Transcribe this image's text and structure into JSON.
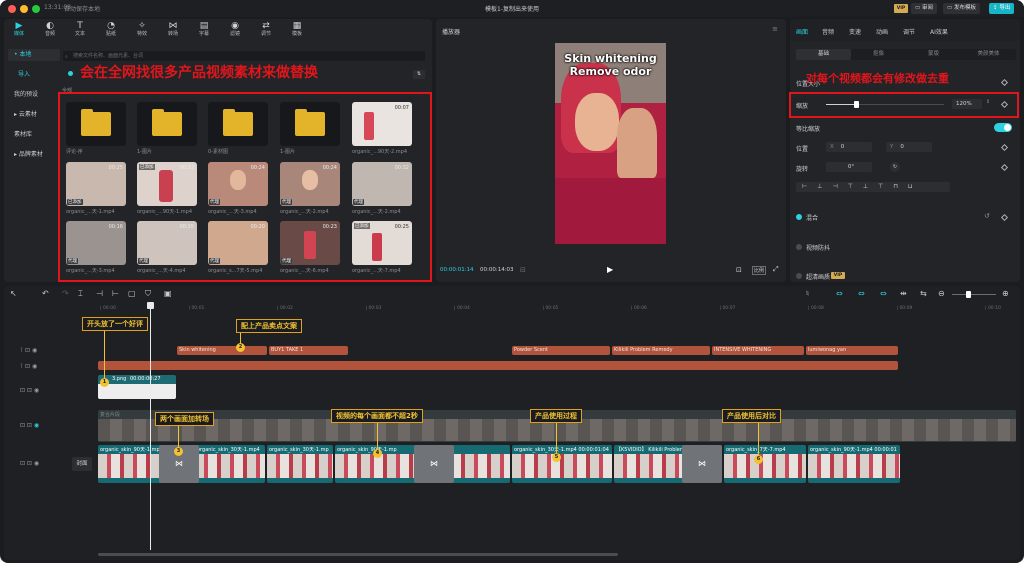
{
  "window": {
    "time": "13:31:08",
    "autosave": "自动保存本地",
    "title": "模板1-复制出来使用",
    "btn_review": "审阅",
    "btn_publish_template": "发布模板",
    "btn_export": "导出",
    "vip": "VIP"
  },
  "toolbar": {
    "items": [
      {
        "label": "媒体",
        "icon": "▶"
      },
      {
        "label": "音频",
        "icon": "◐"
      },
      {
        "label": "文本",
        "icon": "T"
      },
      {
        "label": "贴纸",
        "icon": "◔"
      },
      {
        "label": "特效",
        "icon": "✧"
      },
      {
        "label": "转场",
        "icon": "⋈"
      },
      {
        "label": "字幕",
        "icon": "▤"
      },
      {
        "label": "滤镜",
        "icon": "◉"
      },
      {
        "label": "调节",
        "icon": "⇄"
      },
      {
        "label": "模板",
        "icon": "▦"
      }
    ]
  },
  "sidenav": {
    "local": "• 本地",
    "import": "导入",
    "my_presets": "我的预设",
    "cloud": "▸ 云素材",
    "library": "素材库",
    "brand": "▸ 品牌素材"
  },
  "search": {
    "placeholder": "搜索文件名称、画面元素、台词"
  },
  "media": {
    "all_label": "全部",
    "folders": [
      {
        "name": "评论-序"
      },
      {
        "name": "1-图片"
      },
      {
        "name": "0-素材图"
      },
      {
        "name": "1-图片"
      }
    ],
    "first_clip": {
      "name": "organic_...90天-2.mp4",
      "duration": "00:07"
    },
    "rows": [
      [
        {
          "name": "organic_...天-1.mp4",
          "duration": "00:25",
          "badge": "已添加"
        },
        {
          "name": "organic_...90天-1.mp4",
          "duration": "00:32",
          "badge": "已添加"
        },
        {
          "name": "organic_...天-3.mp4",
          "duration": "00:24",
          "badge": "代理"
        },
        {
          "name": "organic_...天-2.mp4",
          "duration": "00:24",
          "badge": "代理"
        },
        {
          "name": "organic_...天-2.mp4",
          "duration": "00:32",
          "badge": "代理"
        }
      ],
      [
        {
          "name": "organic_...天-3.mp4",
          "duration": "00:16",
          "badge": "代理"
        },
        {
          "name": "organic_...天-4.mp4",
          "duration": "00:15",
          "badge": "代理"
        },
        {
          "name": "organic_s...7天-5.mp4",
          "duration": "00:20",
          "badge": "代理"
        },
        {
          "name": "organic_...天-6.mp4",
          "duration": "00:23",
          "badge": "代理"
        },
        {
          "name": "organic_...天-7.mp4",
          "duration": "00:25",
          "badge": "已添加"
        }
      ]
    ]
  },
  "player": {
    "title": "播放器",
    "overlay_line1": "Skin whitening",
    "overlay_line2": "Remove odor",
    "time_current": "00:00:01:14",
    "time_total": "00:00:14:03",
    "ratio_label": "比例"
  },
  "properties": {
    "tabs": [
      "画面",
      "音频",
      "变速",
      "动画",
      "调节",
      "AI效果"
    ],
    "subtabs": [
      "基础",
      "抠像",
      "蒙版",
      "美颜美体"
    ],
    "section_transform": "位置大小",
    "scale_label": "缩放",
    "scale_value": "120%",
    "uniform_label": "等比缩放",
    "position_label": "位置",
    "pos_x_label": "X",
    "pos_x": "0",
    "pos_y_label": "Y",
    "pos_y": "0",
    "rotation_label": "旋转",
    "rotation_value": "0°",
    "blend_label": "混合",
    "stabilize_label": "视频防抖",
    "hd_label": "超清画质",
    "vip": "VIP"
  },
  "annotations": {
    "media_note": "会在全网找很多产品视频素材来做替换",
    "props_note": "对每个视频都会有修改做去重",
    "good_review": "开头放了一个好评",
    "selling_points": "配上产品卖点文案",
    "transition_note": "两个画面加转场",
    "per_shot": "视频的每个画面都不超2秒",
    "usage": "产品使用过程",
    "compare": "产品使用后对比",
    "dot1": "1",
    "dot2": "2",
    "dot3": "3",
    "dot4": "4",
    "dot5": "5",
    "dot6": "6"
  },
  "timeline": {
    "ruler": [
      "00:00",
      "00:01",
      "00:02",
      "00:03",
      "00:04",
      "00:05",
      "00:06",
      "00:07",
      "00:08",
      "00:09",
      "00:10",
      "00:11",
      "00:12"
    ],
    "text_clips": [
      {
        "label": "Skin whitening"
      },
      {
        "label": "BUY1 TAKE 1"
      },
      {
        "label": "Powder Scent"
      },
      {
        "label": "Kilikili Problem Remedy"
      },
      {
        "label": "INTENSIVE WHITENING"
      },
      {
        "label": "lumiwonag yan"
      }
    ],
    "image_clip": {
      "name": "3.png",
      "time": "00:00:00:27"
    },
    "cover_label": "封面",
    "video_clips": [
      {
        "label": "organic_skin_90天-1.mp"
      },
      {
        "label": "organic_skin_30天-1.mp4"
      },
      {
        "label": "organic_skin_30天-1.mp"
      },
      {
        "label": "organic_skin_90天-1.mp"
      },
      {
        "label": "organic_skin_30天-1.mp4 00:00:01:04"
      },
      {
        "label": "【K5VIDIO】 Kilikili Problem"
      },
      {
        "label": "organic_skin_7天-7.mp4"
      },
      {
        "label": "organic_skin_90天-1.mp4 00:00:01"
      }
    ],
    "overlay_track_label": "复合片段"
  },
  "colors": {
    "accent": "#2ed1e0",
    "annotation_red": "#e0161c",
    "annotation_yellow": "#f2c232",
    "text_clip": "#b2543c",
    "video_clip": "#166a72"
  }
}
